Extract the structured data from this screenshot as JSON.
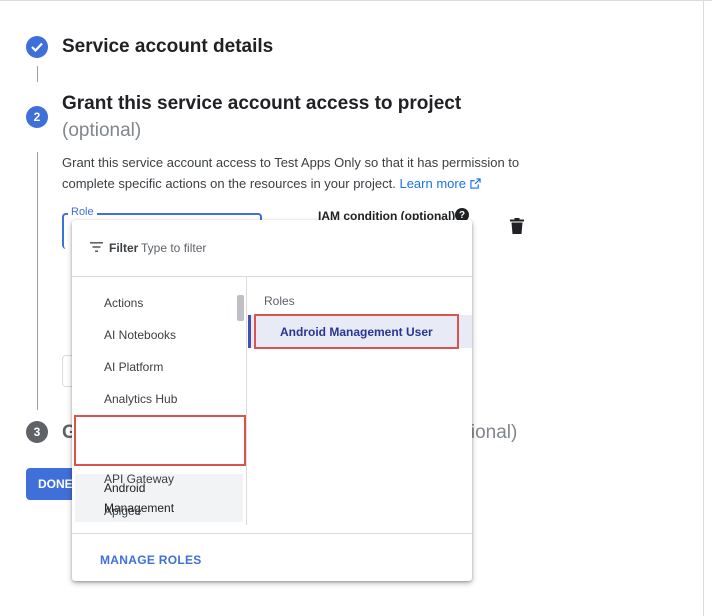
{
  "steps": {
    "step1": {
      "title": "Service account details"
    },
    "step2": {
      "number": "2",
      "title": "Grant this service account access to project",
      "optional": "(optional)",
      "description": "Grant this service account access to Test Apps Only so that it has permission to complete specific actions on the resources in your project.",
      "learn_more": "Learn more"
    },
    "step3": {
      "number": "3",
      "title_start": "G",
      "title_end": "ptional)"
    }
  },
  "role_field": {
    "label": "Role"
  },
  "iam_condition": {
    "label": "IAM condition (optional)",
    "help": "?"
  },
  "done_button": {
    "label": "DONE"
  },
  "dropdown": {
    "filter_label": "Filter",
    "filter_placeholder": "Type to filter",
    "categories": [
      "Actions",
      "AI Notebooks",
      "AI Platform",
      "Analytics Hub",
      "Android Management",
      "API Gateway",
      "Apigee"
    ],
    "selected_category_lines": [
      "Android",
      "Management"
    ],
    "roles_header": "Roles",
    "roles": [
      "Android Management User"
    ],
    "manage_roles": "MANAGE ROLES"
  },
  "colors": {
    "accent": "#3f6fd8",
    "highlight_box": "#d9534f",
    "selected_role_bg": "#e8eaf6",
    "muted": "#80868b"
  },
  "icons": [
    "check-icon",
    "help-icon",
    "trash-icon",
    "filter-icon",
    "external-link-icon"
  ]
}
